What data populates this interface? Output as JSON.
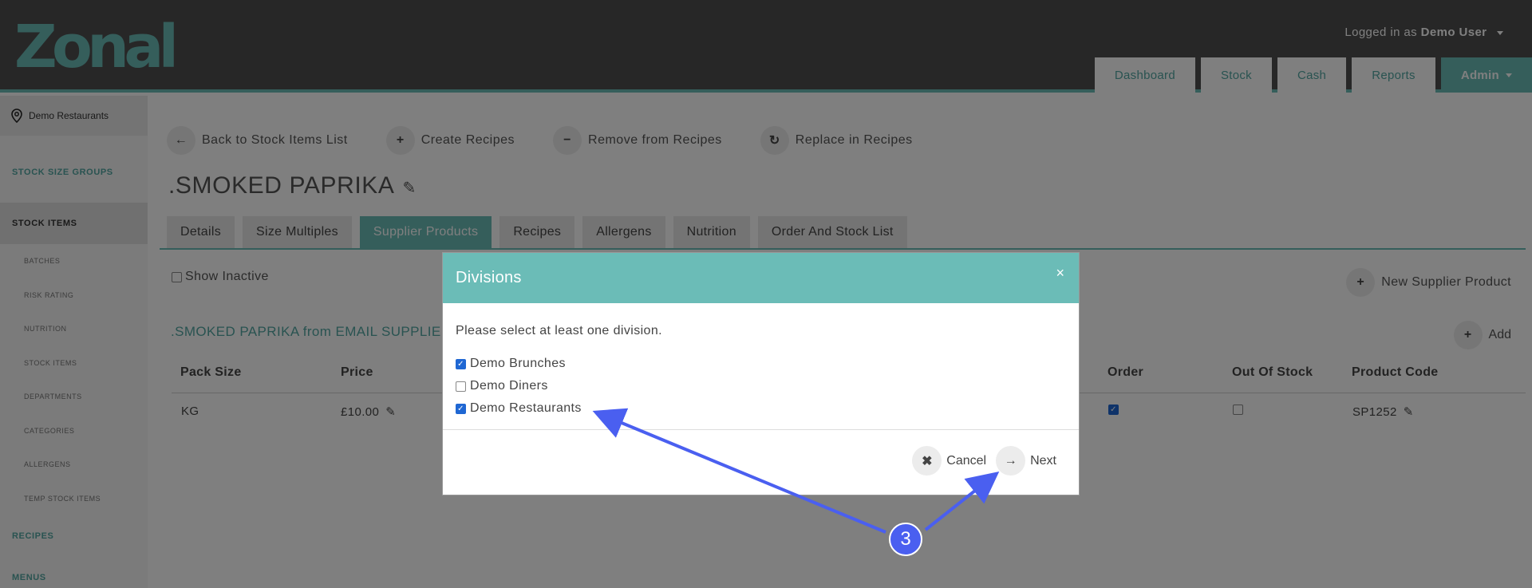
{
  "header": {
    "logo_text": "Zonal",
    "user_prefix": "Logged in as",
    "user_name": "Demo User",
    "nav": [
      "Dashboard",
      "Stock",
      "Cash",
      "Reports",
      "Admin"
    ]
  },
  "sidebar": {
    "location": "Demo Restaurants",
    "sections": {
      "stock_size_groups": "STOCK SIZE GROUPS",
      "stock_items": "STOCK ITEMS",
      "recipes": "RECIPES",
      "menus": "MENUS"
    },
    "sub_items": [
      "BATCHES",
      "RISK RATING",
      "NUTRITION",
      "STOCK ITEMS",
      "DEPARTMENTS",
      "CATEGORIES",
      "ALLERGENS",
      "TEMP STOCK ITEMS"
    ]
  },
  "actions": [
    "Back to Stock Items List",
    "Create Recipes",
    "Remove from Recipes",
    "Replace in Recipes"
  ],
  "page_title": ".SMOKED PAPRIKA",
  "tabs": [
    "Details",
    "Size Multiples",
    "Supplier Products",
    "Recipes",
    "Allergens",
    "Nutrition",
    "Order And Stock List"
  ],
  "show_inactive": "Show Inactive",
  "new_supplier_product": "New Supplier Product",
  "add": "Add",
  "section_title": ".SMOKED PAPRIKA from EMAIL SUPPLIER",
  "table": {
    "headers": {
      "pack_size": "Pack Size",
      "price": "Price",
      "order": "Order",
      "out_of_stock": "Out Of Stock",
      "product_code": "Product Code"
    },
    "row": {
      "pack_size": "KG",
      "price": "£10.00",
      "order": true,
      "out_of_stock": false,
      "product_code": "SP1252"
    }
  },
  "modal": {
    "title": "Divisions",
    "close": "×",
    "prompt": "Please select at least one division.",
    "options": [
      {
        "label": "Demo Brunches",
        "checked": true
      },
      {
        "label": "Demo Diners",
        "checked": false
      },
      {
        "label": "Demo Restaurants",
        "checked": true
      }
    ],
    "cancel": "Cancel",
    "next": "Next"
  },
  "annotation": {
    "step": "3",
    "color": "#4a5ff0"
  },
  "colors": {
    "teal": "#6bbcb7",
    "header": "#4f4f4f",
    "checkbox": "#1f67d3"
  }
}
